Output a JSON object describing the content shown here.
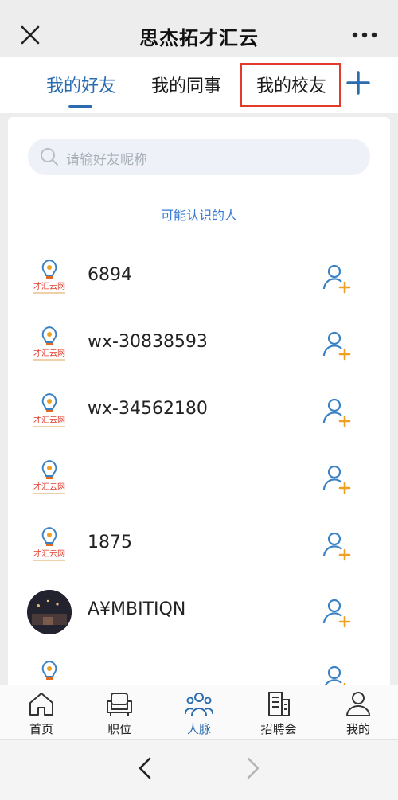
{
  "header": {
    "title": "思杰拓才汇云",
    "close_icon": "close-icon",
    "more_icon": "more-icon"
  },
  "tabs": [
    {
      "label": "我的好友",
      "active": true
    },
    {
      "label": "我的同事",
      "active": false
    },
    {
      "label": "我的校友",
      "active": false
    }
  ],
  "search": {
    "placeholder": "请输好友昵称"
  },
  "section_title": "可能认识的人",
  "people": [
    {
      "name": "6894",
      "avatar": "cai-hui-yun-logo"
    },
    {
      "name": "wx-30838593",
      "avatar": "cai-hui-yun-logo"
    },
    {
      "name": "wx-34562180",
      "avatar": "cai-hui-yun-logo"
    },
    {
      "name": "",
      "avatar": "cai-hui-yun-logo"
    },
    {
      "name": "1875",
      "avatar": "cai-hui-yun-logo"
    },
    {
      "name": "A¥MBITIQN",
      "avatar": "photo"
    },
    {
      "name": "",
      "avatar": "cai-hui-yun-logo"
    }
  ],
  "logo_text": "才汇云网",
  "bottom_nav": [
    {
      "label": "首页",
      "icon": "home-icon",
      "active": false
    },
    {
      "label": "职位",
      "icon": "sofa-icon",
      "active": false
    },
    {
      "label": "人脉",
      "icon": "people-icon",
      "active": true
    },
    {
      "label": "招聘会",
      "icon": "building-icon",
      "active": false
    },
    {
      "label": "我的",
      "icon": "user-icon",
      "active": false
    }
  ],
  "colors": {
    "accent": "#2b6cb0",
    "highlight_box": "#e03a2a",
    "add_badge": "#f0a020"
  }
}
